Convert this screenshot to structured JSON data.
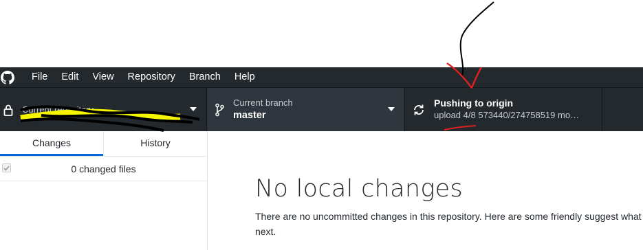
{
  "menubar": {
    "items": [
      "File",
      "Edit",
      "View",
      "Repository",
      "Branch",
      "Help"
    ]
  },
  "toolbar": {
    "repository": {
      "label": "Current repository",
      "value": ""
    },
    "branch": {
      "label": "Current branch",
      "value": "master"
    },
    "push": {
      "label": "Pushing to origin",
      "value": "upload 4/8 573440/274758519 mo…"
    }
  },
  "sidebar": {
    "tabs": [
      {
        "label": "Changes",
        "active": true
      },
      {
        "label": "History",
        "active": false
      }
    ],
    "changes_count": "0 changed files"
  },
  "main": {
    "title": "No local changes",
    "description": "There are no uncommitted changes in this repository. Here are some friendly suggest what to do next."
  },
  "colors": {
    "chrome": "#24292e",
    "branch_bg": "#2f363d",
    "active_tab": "#0366d6",
    "annotation_black": "#000000",
    "annotation_red": "#e02020",
    "redaction_yellow": "#ffff00"
  },
  "icons": [
    "github-logo-icon",
    "lock-icon",
    "git-branch-icon",
    "sync-icon",
    "caret-down-icon",
    "checkbox-check-icon"
  ]
}
